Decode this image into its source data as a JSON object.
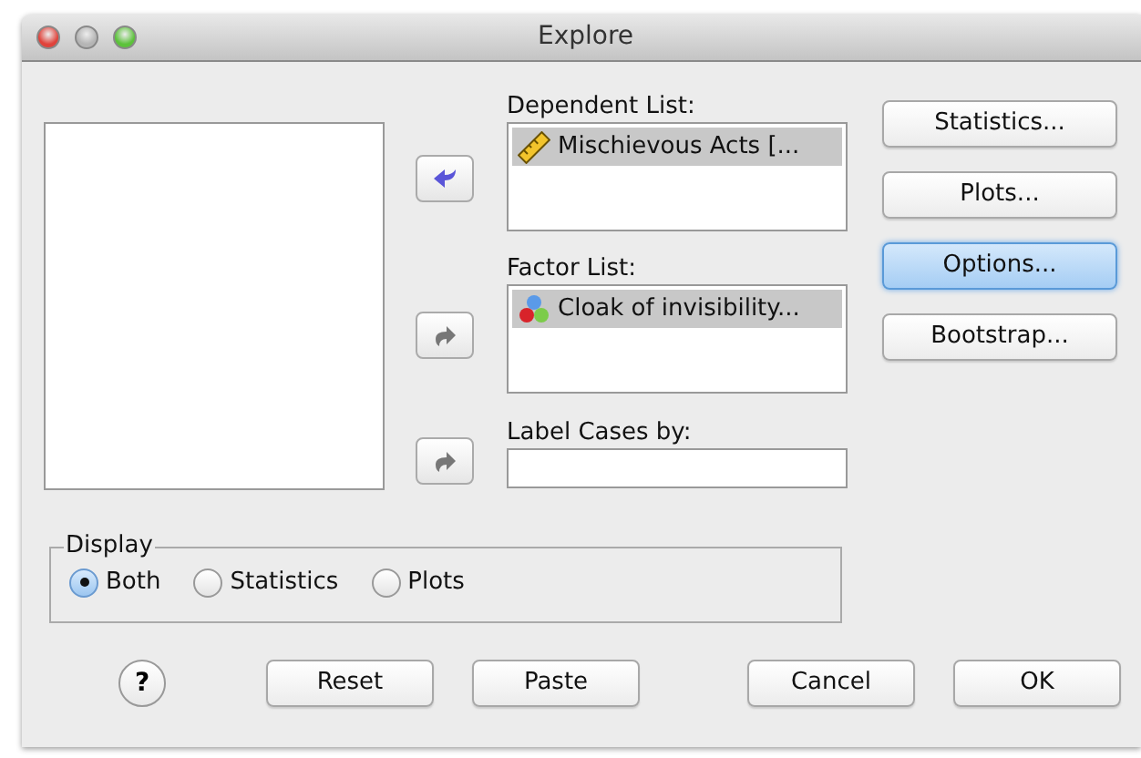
{
  "window": {
    "title": "Explore"
  },
  "move_buttons": [
    {
      "disabled": false
    },
    {
      "disabled": true
    },
    {
      "disabled": true
    }
  ],
  "dependent_list": {
    "label": "Dependent List:",
    "items": [
      {
        "kind": "scale",
        "text": "Mischievous Acts [...",
        "selected": true
      }
    ]
  },
  "factor_list": {
    "label": "Factor List:",
    "items": [
      {
        "kind": "nominal",
        "text": "Cloak of invisibility...",
        "selected": true
      }
    ]
  },
  "label_cases": {
    "label": "Label Cases by:"
  },
  "side_buttons": [
    {
      "label": "Statistics...",
      "focused": false
    },
    {
      "label": "Plots...",
      "focused": false
    },
    {
      "label": "Options...",
      "focused": true
    },
    {
      "label": "Bootstrap...",
      "focused": false
    }
  ],
  "display": {
    "legend": "Display",
    "options": [
      {
        "label": "Both",
        "selected": true
      },
      {
        "label": "Statistics",
        "selected": false
      },
      {
        "label": "Plots",
        "selected": false
      }
    ]
  },
  "help_button": {
    "label": "?"
  },
  "bottom_buttons": [
    {
      "label": "Reset"
    },
    {
      "label": "Paste"
    },
    {
      "label": "Cancel"
    },
    {
      "label": "OK"
    }
  ]
}
